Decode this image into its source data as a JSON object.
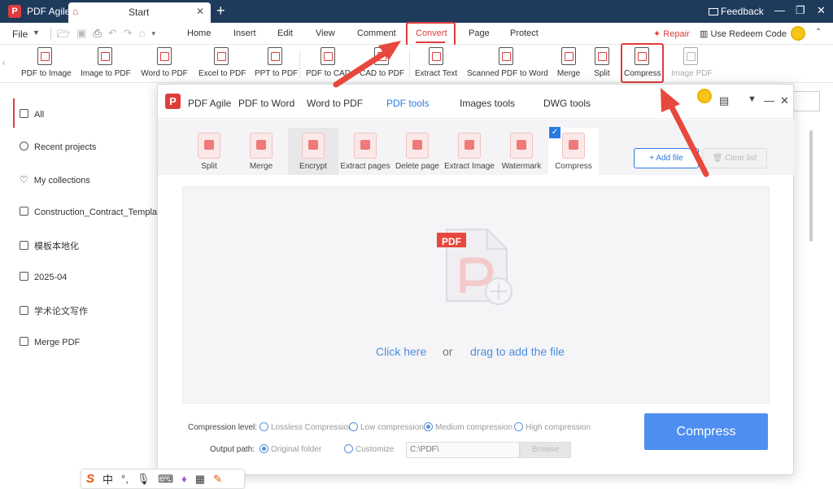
{
  "titlebar": {
    "app_name": "PDF Agile",
    "tab_label": "Start",
    "feedback": "Feedback"
  },
  "menubar": {
    "file": "File",
    "items": [
      "Home",
      "Insert",
      "Edit",
      "View",
      "Comment",
      "Convert",
      "Page",
      "Protect"
    ],
    "active": "Convert",
    "repair": "Repair",
    "redeem": "Use Redeem Code"
  },
  "ribbon": {
    "items": [
      "PDF to Image",
      "Image to PDF",
      "Word to PDF",
      "Excel to PDF",
      "PPT to PDF",
      "PDF to CAD",
      "CAD to PDF",
      "Extract Text",
      "Scanned PDF to Word",
      "Merge",
      "Split",
      "Compress",
      "Image PDF"
    ],
    "highlighted": "Compress",
    "disabled": "Image PDF"
  },
  "sidebar": {
    "items": [
      {
        "label": "All",
        "icon": "grid-icon"
      },
      {
        "label": "Recent projects",
        "icon": "clock-icon"
      },
      {
        "label": "My collections",
        "icon": "heart-icon"
      },
      {
        "label": "Construction_Contract_Templa...",
        "icon": "folder-icon"
      },
      {
        "label": "模板本地化",
        "icon": "folder-icon"
      },
      {
        "label": "2025-04",
        "icon": "folder-icon"
      },
      {
        "label": "学术论文写作",
        "icon": "folder-icon"
      },
      {
        "label": "Merge PDF",
        "icon": "folder-icon"
      }
    ]
  },
  "dialog": {
    "title": "PDF Agile",
    "tabs": [
      "PDF to Word",
      "Word to PDF",
      "PDF tools",
      "Images tools",
      "DWG tools"
    ],
    "active_tab": "PDF tools",
    "tools": [
      "Split",
      "Merge",
      "Encrypt",
      "Extract pages",
      "Delete page",
      "Extract Image",
      "Watermark",
      "Compress"
    ],
    "active_tool": "Compress",
    "add_file": "Add file",
    "clear_list": "Clear list",
    "drop": {
      "badge": "PDF",
      "click_here": "Click here",
      "or": "or",
      "drag": "drag to add the file"
    },
    "compression_label": "Compression level:",
    "levels": [
      "Lossless Compression",
      "Low compression",
      "Medium compression",
      "High compression"
    ],
    "selected_level": "Medium compression",
    "output_label": "Output path:",
    "output_options": [
      "Original folder",
      "Customize"
    ],
    "selected_output": "Original folder",
    "path_value": "C:\\PDF\\",
    "browse": "Browse",
    "compress_button": "Compress"
  },
  "ime": {
    "logo": "S",
    "mode": "中",
    "punct": "°,"
  },
  "colors": {
    "accent_red": "#e03c3c",
    "accent_blue": "#2a7be4",
    "titlebar": "#1f3b5c",
    "compress_button": "#4d8ef0"
  }
}
